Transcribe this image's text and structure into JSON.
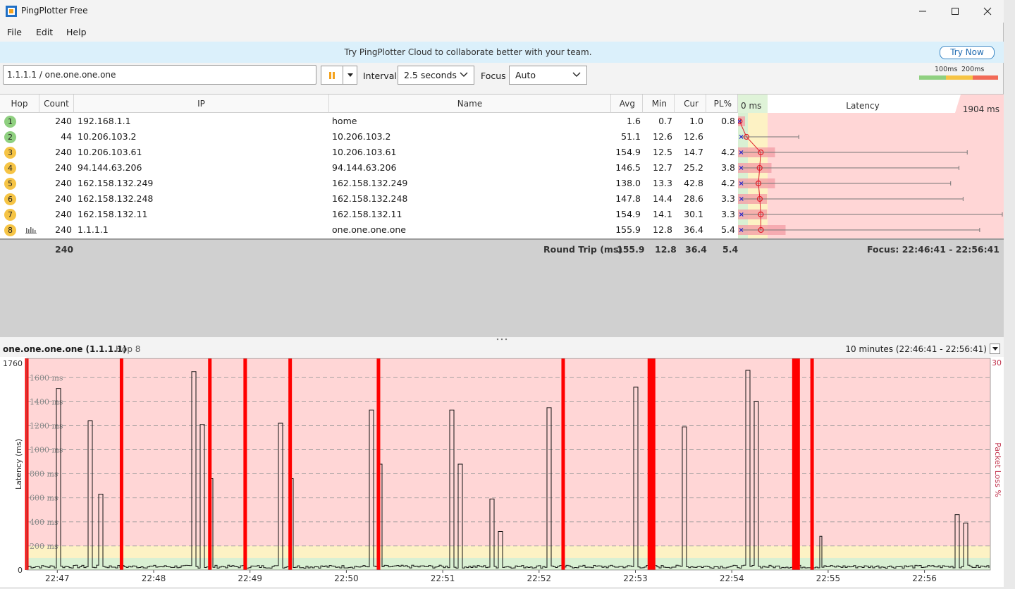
{
  "window": {
    "title": "PingPlotter Free"
  },
  "menu": [
    "File",
    "Edit",
    "Help"
  ],
  "banner": {
    "text": "Try PingPlotter Cloud to collaborate better with your team.",
    "button": "Try Now"
  },
  "toolbar": {
    "target": "1.1.1.1 / one.one.one.one",
    "interval_label": "Interval",
    "interval_value": "2.5 seconds",
    "focus_label": "Focus",
    "focus_value": "Auto",
    "scale_100": "100ms",
    "scale_200": "200ms"
  },
  "colors": {
    "good": "#7ec86a",
    "warn": "#f6c445",
    "bad": "#f26a57",
    "loss_bar": "#ff0000"
  },
  "columns": {
    "hop": "Hop",
    "count": "Count",
    "ip": "IP",
    "name": "Name",
    "avg": "Avg",
    "min": "Min",
    "cur": "Cur",
    "pl": "PL%",
    "latency": "Latency",
    "lat_min": "0 ms",
    "lat_max": "1904 ms"
  },
  "hops": [
    {
      "hop": "1",
      "count": "240",
      "ip": "192.168.1.1",
      "name": "home",
      "avg": "1.6",
      "min": "0.7",
      "cur": "1.0",
      "pl": "0.8",
      "status": "good",
      "avg_ms": 1.6,
      "min_ms": 0.7,
      "max_ms": 8,
      "pl_pct": 0.8
    },
    {
      "hop": "2",
      "count": "44",
      "ip": "10.206.103.2",
      "name": "10.206.103.2",
      "avg": "51.1",
      "min": "12.6",
      "cur": "12.6",
      "pl": "",
      "status": "good",
      "avg_ms": 51.1,
      "min_ms": 12.6,
      "max_ms": 430,
      "pl_pct": 0
    },
    {
      "hop": "3",
      "count": "240",
      "ip": "10.206.103.61",
      "name": "10.206.103.61",
      "avg": "154.9",
      "min": "12.5",
      "cur": "14.7",
      "pl": "4.2",
      "status": "warn",
      "avg_ms": 154.9,
      "min_ms": 12.5,
      "max_ms": 1650,
      "pl_pct": 4.2
    },
    {
      "hop": "4",
      "count": "240",
      "ip": "94.144.63.206",
      "name": "94.144.63.206",
      "avg": "146.5",
      "min": "12.7",
      "cur": "25.2",
      "pl": "3.8",
      "status": "warn",
      "avg_ms": 146.5,
      "min_ms": 12.7,
      "max_ms": 1590,
      "pl_pct": 3.8
    },
    {
      "hop": "5",
      "count": "240",
      "ip": "162.158.132.249",
      "name": "162.158.132.249",
      "avg": "138.0",
      "min": "13.3",
      "cur": "42.8",
      "pl": "4.2",
      "status": "warn",
      "avg_ms": 138.0,
      "min_ms": 13.3,
      "max_ms": 1530,
      "pl_pct": 4.2
    },
    {
      "hop": "6",
      "count": "240",
      "ip": "162.158.132.248",
      "name": "162.158.132.248",
      "avg": "147.8",
      "min": "14.4",
      "cur": "28.6",
      "pl": "3.3",
      "status": "warn",
      "avg_ms": 147.8,
      "min_ms": 14.4,
      "max_ms": 1620,
      "pl_pct": 3.3
    },
    {
      "hop": "7",
      "count": "240",
      "ip": "162.158.132.11",
      "name": "162.158.132.11",
      "avg": "154.9",
      "min": "14.1",
      "cur": "30.1",
      "pl": "3.3",
      "status": "warn",
      "avg_ms": 154.9,
      "min_ms": 14.1,
      "max_ms": 1904,
      "pl_pct": 3.3
    },
    {
      "hop": "8",
      "count": "240",
      "ip": "1.1.1.1",
      "name": "one.one.one.one",
      "avg": "155.9",
      "min": "12.8",
      "cur": "36.4",
      "pl": "5.4",
      "status": "warn",
      "avg_ms": 155.9,
      "min_ms": 12.8,
      "max_ms": 1740,
      "pl_pct": 5.4
    }
  ],
  "summary": {
    "count": "240",
    "label": "Round Trip (ms)",
    "avg": "155.9",
    "min": "12.8",
    "cur": "36.4",
    "pl": "5.4",
    "focus": "Focus: 22:46:41 - 22:56:41"
  },
  "graph": {
    "title": "one.one.one.one (1.1.1.1)",
    "hop": "Hop 8",
    "range": "10 minutes (22:46:41 - 22:56:41)",
    "y_max": "1760",
    "y_min": "0",
    "y_axis_label": "Latency (ms)",
    "right_axis_label": "Packet Loss %",
    "right_max": "30",
    "y_ticks": [
      "1600 ms",
      "1400 ms",
      "1200 ms",
      "1000 ms",
      "800 ms",
      "600 ms",
      "400 ms",
      "200 ms"
    ],
    "x_ticks": [
      "22:47",
      "22:48",
      "22:49",
      "22:50",
      "22:51",
      "22:52",
      "22:53",
      "22:54",
      "22:55",
      "22:56"
    ]
  },
  "chart_data": {
    "type": "line",
    "x_label": "",
    "y_label": "Latency (ms)",
    "ylim": [
      0,
      1760
    ],
    "right_ylim": [
      0,
      30
    ],
    "x_ticks": [
      "22:47",
      "22:48",
      "22:49",
      "22:50",
      "22:51",
      "22:52",
      "22:53",
      "22:54",
      "22:55",
      "22:56"
    ],
    "grid": true,
    "series": [
      {
        "name": "Latency (ms)",
        "spikes": [
          {
            "t": "22:47:00",
            "v": 1510
          },
          {
            "t": "22:47:20",
            "v": 1240
          },
          {
            "t": "22:47:27",
            "v": 630
          },
          {
            "t": "22:48:25",
            "v": 1650
          },
          {
            "t": "22:48:30",
            "v": 1210
          },
          {
            "t": "22:48:35",
            "v": 760
          },
          {
            "t": "22:49:18",
            "v": 1220
          },
          {
            "t": "22:49:25",
            "v": 760
          },
          {
            "t": "22:50:15",
            "v": 1330
          },
          {
            "t": "22:50:20",
            "v": 880
          },
          {
            "t": "22:51:05",
            "v": 1330
          },
          {
            "t": "22:51:10",
            "v": 880
          },
          {
            "t": "22:51:30",
            "v": 590
          },
          {
            "t": "22:51:35",
            "v": 320
          },
          {
            "t": "22:52:05",
            "v": 1350
          },
          {
            "t": "22:53:00",
            "v": 1520
          },
          {
            "t": "22:53:30",
            "v": 1190
          },
          {
            "t": "22:54:10",
            "v": 1660
          },
          {
            "t": "22:54:15",
            "v": 1400
          },
          {
            "t": "22:56:20",
            "v": 460
          },
          {
            "t": "22:56:25",
            "v": 390
          }
        ]
      }
    ],
    "packet_loss_times": [
      "22:46:41",
      "22:47:40",
      "22:48:35",
      "22:48:57",
      "22:49:25",
      "22:50:20",
      "22:52:15",
      "22:53:10",
      "22:54:40",
      "22:54:50"
    ]
  }
}
